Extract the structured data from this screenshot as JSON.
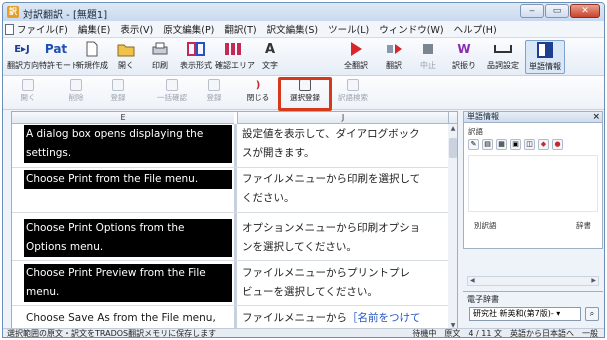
{
  "window": {
    "title": "対訳翻訳 - [無題1]",
    "controls": [
      "‒",
      "▭",
      "✕"
    ]
  },
  "menu": [
    "ファイル(F)",
    "編集(E)",
    "表示(V)",
    "原文編集(P)",
    "翻訳(T)",
    "訳文編集(S)",
    "ツール(L)",
    "ウィンドウ(W)",
    "ヘルプ(H)"
  ],
  "toolbar1": {
    "direction": "翻訳方向",
    "mode": "特許モード",
    "new": "新規作成",
    "open": "開く",
    "print": "印刷",
    "display_format": "表示形式",
    "confirm_area": "確認エリア",
    "text": "文字",
    "translate_all": "全翻訳",
    "translate": "翻訳",
    "stop": "中止",
    "dict": "訳振り",
    "settings": "品詞設定",
    "word_info": "単語情報",
    "direction_icon": "E▸J",
    "pat_icon": "Pat"
  },
  "toolbar2": {
    "open_btn": "開く",
    "delete_btn": "削除",
    "bulk_confirm": "一括確認",
    "confirm": "登録",
    "close": "閉じる",
    "select_register": "選択登録",
    "search": "訳語検索"
  },
  "grid": {
    "col_e": "E",
    "col_j": "J",
    "rows": [
      {
        "src": [
          "A dialog box opens displaying the",
          "settings."
        ],
        "tgt": [
          "設定値を表示して、ダイアログボック",
          "スが開きます。"
        ],
        "highlighted": true
      },
      {
        "src": [
          "Choose Print from the File menu."
        ],
        "tgt": [
          "ファイルメニューから印刷を選択して",
          "ください。"
        ],
        "highlighted": true
      },
      {
        "src": [
          "Choose Print Options from the",
          "Options menu."
        ],
        "tgt": [
          "オプションメニューから印刷オプショ",
          "ンを選択してください。"
        ],
        "highlighted": true
      },
      {
        "src": [
          "Choose Print Preview from the File",
          "menu."
        ],
        "tgt": [
          "ファイルメニューからプリントプレ",
          "ビューを選択してください。"
        ],
        "highlighted": true
      },
      {
        "src": [
          "Choose Save As from the File menu,"
        ],
        "tgt_plain": "ファイルメニューから",
        "tgt_blue": "［名前をつけて",
        "highlighted": false
      }
    ]
  },
  "pane": {
    "title": "単語情報",
    "close": "×",
    "original_label": "訳語",
    "other_label": "別訳語",
    "dict_label": "辞書",
    "dict_title": "電子辞書",
    "dict_selected": "研究社 新英和(第7版)- ▾"
  },
  "status": {
    "left": "選択範囲の原文・訳文をTRADOS翻訳メモリに保存します",
    "waiting": "待機中",
    "text": "原文",
    "position": "4 / 11 文",
    "direction": "英語から日本語へ",
    "mode": "一般"
  },
  "colors": {
    "highlight": "#d43a1a",
    "selected_row_bg": "#000000",
    "accent_blue": "#2456c5"
  }
}
